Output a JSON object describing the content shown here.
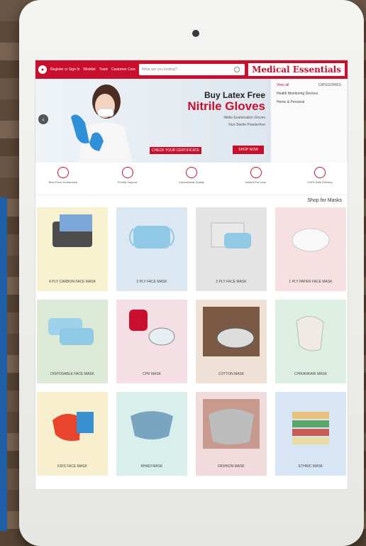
{
  "header": {
    "logo": "Medical Essentials",
    "search_placeholder": "What are you looking?",
    "links": [
      "Customer Care",
      "Track",
      "Wishlist",
      "Register or Sign In"
    ],
    "brand_color": "#c8102e"
  },
  "categories": {
    "heading": "CATEGORIES",
    "view_all": "View all",
    "items": [
      "Health Monitoring Devices",
      "Home & Personal"
    ]
  },
  "banner": {
    "title_line1": "Buy Latex Free",
    "title_line2": "Nitrile Gloves",
    "sub_line1": "Nitrile Examination Gloves",
    "sub_line2": "Non Sterile Powderfree",
    "badge": "CHECK YOUR CERTIFICATE",
    "shop_now": "SHOP NOW"
  },
  "features": [
    {
      "label": "100% Safe Delivery",
      "icon": "truck-icon"
    },
    {
      "label": "Instant Pre-book",
      "icon": "clock-icon"
    },
    {
      "label": "International Quality",
      "icon": "map-icon"
    },
    {
      "label": "Priority Support",
      "icon": "support-icon"
    },
    {
      "label": "Best Price Guaranteed",
      "icon": "price-tag-icon"
    }
  ],
  "section_title": "Shop for Masks",
  "products": [
    {
      "name": "1 PLY PAPER FACE MASK",
      "bg": "#f6e0e1"
    },
    {
      "name": "2 PLY FACE MASK",
      "bg": "#e4e4e4"
    },
    {
      "name": "3 PLY FACE MASK",
      "bg": "#dce8f1"
    },
    {
      "name": "4 PLY CARBON FACE MASK",
      "bg": "#f7f1cf"
    },
    {
      "name": "CHIKANKARI MASK",
      "bg": "#dcefe2"
    },
    {
      "name": "COTTON MASK",
      "bg": "#efe1d6"
    },
    {
      "name": "CPR MASK",
      "bg": "#f4e0e4"
    },
    {
      "name": "DISPOSABLE FACE MASK",
      "bg": "#dce9d7"
    },
    {
      "name": "ETHNIC MASK",
      "bg": "#d8e5f4"
    },
    {
      "name": "FASHION MASK",
      "bg": "#f2dbdc"
    },
    {
      "name": "KHADI MASK",
      "bg": "#d8efec"
    },
    {
      "name": "KIDS FACE MASK",
      "bg": "#f7efcd"
    }
  ]
}
